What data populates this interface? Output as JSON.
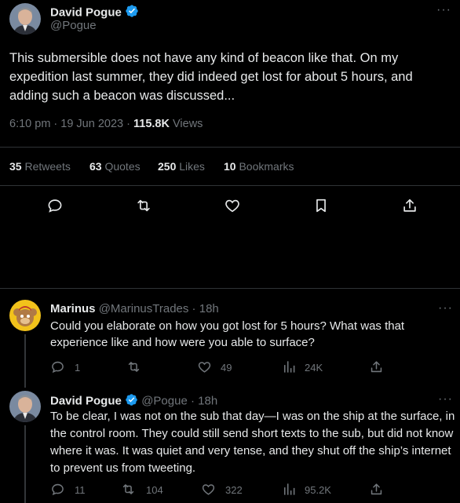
{
  "main_tweet": {
    "author_name": "David Pogue",
    "author_handle": "@Pogue",
    "text": "This submersible does not have any kind of beacon like that. On my expedition last summer, they did indeed get lost for about 5 hours, and adding such a beacon was discussed...",
    "time": "6:10 pm · 19 Jun 2023 · ",
    "views_count": "115.8K",
    "views_label": " Views",
    "stats": {
      "retweets_count": "35",
      "retweets_label": "Retweets",
      "quotes_count": "63",
      "quotes_label": "Quotes",
      "likes_count": "250",
      "likes_label": "Likes",
      "bookmarks_count": "10",
      "bookmarks_label": "Bookmarks"
    }
  },
  "reply1": {
    "author_name": "Marinus",
    "author_handle": "@MarinusTrades · 18h",
    "text": "Could you elaborate on how you got lost for 5 hours? What was that experience like and how were you able to surface?",
    "replies": "1",
    "likes": "49",
    "views": "24K"
  },
  "reply2": {
    "author_name": "David Pogue",
    "author_handle": "@Pogue · 18h",
    "text": "To be clear, I was not on the sub that day—I was on the ship at the surface, in the control room. They could still send short texts to the sub, but did not know where it was. It was quiet and very tense, and they shut off the ship’s internet to prevent us from tweeting.",
    "replies": "11",
    "retweets": "104",
    "likes": "322",
    "views": "95.2K"
  },
  "more_glyph": "···",
  "colors": {
    "background": "#000000",
    "text": "#e7e9ea",
    "secondary": "#71767b",
    "verified": "#1d9bf0",
    "divider": "#2f3336"
  },
  "icons": [
    "verified-badge-icon",
    "reply-icon",
    "retweet-icon",
    "like-icon",
    "bookmark-icon",
    "share-icon",
    "views-icon",
    "more-icon"
  ]
}
